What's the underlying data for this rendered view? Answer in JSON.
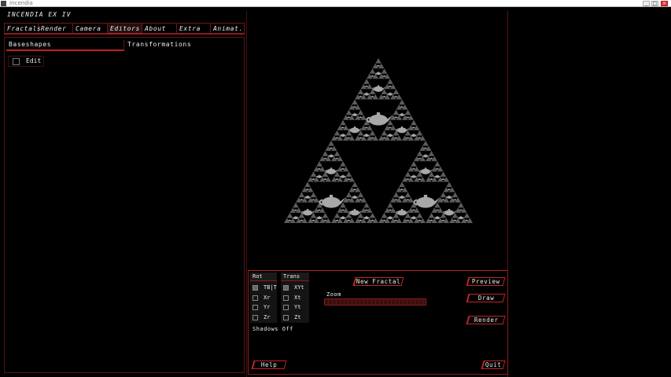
{
  "window": {
    "title": "Incendia",
    "controls": [
      "_",
      "□",
      "×"
    ]
  },
  "app": {
    "name": "INCENDIA EX IV"
  },
  "tabs": [
    {
      "label": "Fractals"
    },
    {
      "label": "Render"
    },
    {
      "label": "Camera"
    },
    {
      "label": "Editors"
    },
    {
      "label": "About"
    },
    {
      "label": "Extra"
    },
    {
      "label": "Animat."
    }
  ],
  "active_tab": "Editors",
  "subtabs": [
    {
      "label": "Baseshapes"
    },
    {
      "label": "Transformations"
    }
  ],
  "active_subtab": "Baseshapes",
  "edit_checkbox": {
    "label": "Edit",
    "checked": false
  },
  "render_view": {
    "content": "Sierpinski triangle fractal of teapots"
  },
  "rot": {
    "header": "Rot",
    "items": [
      {
        "label": "TB|T",
        "checked": true
      },
      {
        "label": "Xr",
        "checked": false
      },
      {
        "label": "Yr",
        "checked": false
      },
      {
        "label": "Zr",
        "checked": false
      }
    ]
  },
  "trans": {
    "header": "Trans",
    "items": [
      {
        "label": "XYt",
        "checked": true
      },
      {
        "label": "Xt",
        "checked": false
      },
      {
        "label": "Yt",
        "checked": false
      },
      {
        "label": "Zt",
        "checked": false
      }
    ]
  },
  "shadows": "Shadows  Off",
  "buttons": {
    "new_fractal": "New Fractal",
    "preview": "Preview",
    "draw": "Draw",
    "render": "Render",
    "help": "Help",
    "quit": "Quit"
  },
  "zoom": {
    "label": "Zoom",
    "value": 1.0
  },
  "colors": {
    "accent": "#c52525",
    "background": "#000000",
    "fractal": "#a8a8a8"
  }
}
